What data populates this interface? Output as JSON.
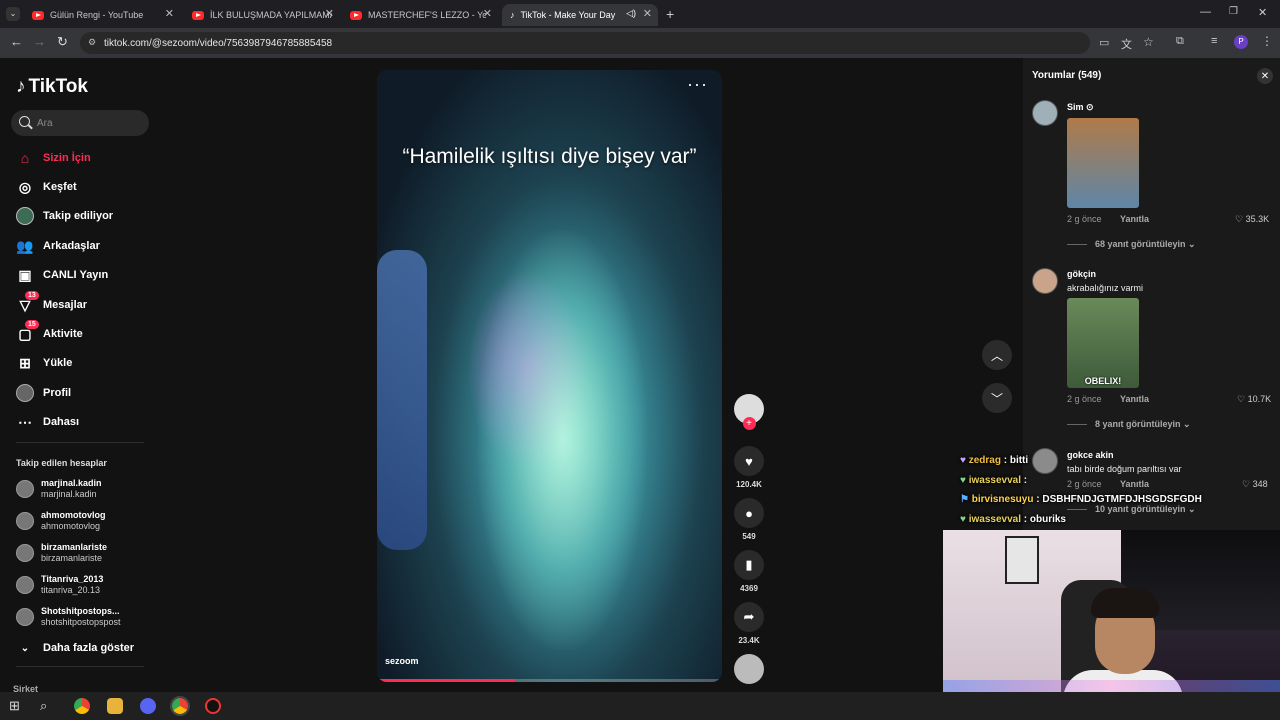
{
  "browser": {
    "tabs": [
      {
        "title": "Gülün Rengi - YouTube"
      },
      {
        "title": "İLK BULUŞMADA YAPILMAMAS"
      },
      {
        "title": "MASTERCHEF'S LEZZO - YouTu"
      },
      {
        "title": "TikTok - Make Your Day"
      }
    ],
    "url": "tiktok.com/@sezoom/video/7563987946785885458",
    "profile_letter": "P"
  },
  "tiktok": {
    "logo": "TikTok",
    "search_placeholder": "Ara",
    "nav": [
      {
        "label": "Sizin İçin",
        "icon": "home-icon"
      },
      {
        "label": "Keşfet",
        "icon": "compass-icon"
      },
      {
        "label": "Takip ediliyor",
        "icon": "following-avatar"
      },
      {
        "label": "Arkadaşlar",
        "icon": "friends-icon"
      },
      {
        "label": "CANLI Yayın",
        "icon": "live-icon"
      },
      {
        "label": "Mesajlar",
        "icon": "message-icon",
        "badge": "13"
      },
      {
        "label": "Aktivite",
        "icon": "activity-icon",
        "badge": "15"
      },
      {
        "label": "Yükle",
        "icon": "upload-icon"
      },
      {
        "label": "Profil",
        "icon": "profile-avatar"
      },
      {
        "label": "Dahası",
        "icon": "more-icon"
      }
    ],
    "following_title": "Takip edilen hesaplar",
    "following": [
      {
        "name": "marjinal.kadin",
        "handle": "marjinal.kadin"
      },
      {
        "name": "ahmomotovlog",
        "handle": "ahmomotovlog"
      },
      {
        "name": "birzamanlariste",
        "handle": "birzamanlariste"
      },
      {
        "name": "Titanriva_2013",
        "handle": "titanriva_20.13"
      },
      {
        "name": "Shotshitpostops...",
        "handle": "shotshitpostopspost"
      }
    ],
    "show_more": "Daha fazla göster",
    "footer_label": "Şirket"
  },
  "video": {
    "caption": "“Hamilelik ışıltısı diye bişey var”",
    "author": "sezoom",
    "progress_fraction": 0.4,
    "likes": "120.4K",
    "comments": "549",
    "saves": "4369",
    "shares": "23.4K"
  },
  "comments": {
    "title": "Yorumlar (549)",
    "items": [
      {
        "user": "Sim ⊙",
        "text": "",
        "time": "2 g önce",
        "reply": "Yanıtla",
        "likes": "35.3K",
        "replies": "68 yanıt görüntüleyin"
      },
      {
        "user": "gökçin",
        "text": "akrabalığınız varmi",
        "image_caption": "OBELIX!",
        "time": "2 g önce",
        "reply": "Yanıtla",
        "likes": "10.7K",
        "replies": "8 yanıt görüntüleyin"
      },
      {
        "user": "gokce akin",
        "text": "tabı birde doğum parıltısı var",
        "time": "2 g önce",
        "reply": "Yanıtla",
        "likes": "348",
        "replies": "10 yanıt görüntüleyin"
      }
    ]
  },
  "chat": [
    {
      "user": "zedrag",
      "msg": "bitti"
    },
    {
      "user": "iwassevval",
      "msg": ""
    },
    {
      "user": "birvisnesuyu",
      "msg": "DSBHFNDJGTMFDJHSGDSFGDH"
    },
    {
      "user": "iwassevval",
      "msg": "oburiks"
    }
  ],
  "colors": {
    "accent": "#fe2c55",
    "page_bg": "#121212",
    "panel_bg": "#1a1a1a"
  }
}
